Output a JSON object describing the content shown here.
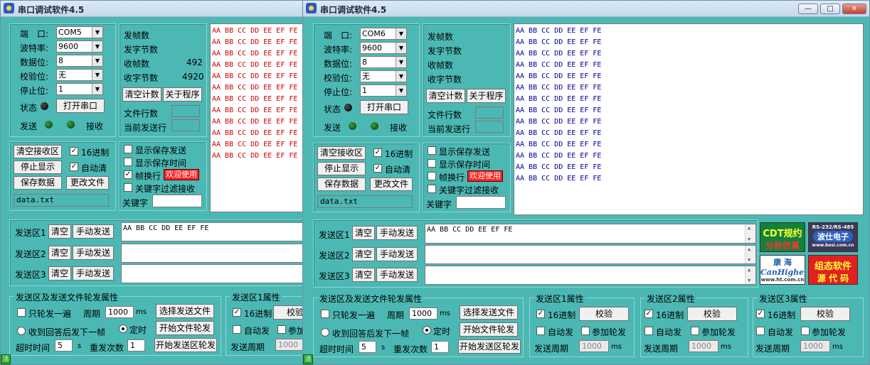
{
  "title": "串口调试软件4.5",
  "window_controls": {
    "minimize": "—",
    "maximize": "□",
    "close": "✕"
  },
  "labels": {
    "port": "端　口:",
    "baud": "波特率:",
    "databits": "数据位:",
    "parity": "校验位:",
    "stopbits": "停止位:",
    "state": "状态",
    "open_port": "打开串口",
    "send": "发送",
    "recv": "接收",
    "tx_frames": "发帧数",
    "tx_bytes": "发字节数",
    "rx_frames": "收帧数",
    "rx_bytes": "收字节数",
    "clear_count": "清空计数",
    "about": "关于程序",
    "file_lines": "文件行数",
    "current_line": "当前发送行",
    "clear_recv": "清空接收区",
    "hex16": "16进制",
    "stop_display": "停止显示",
    "auto_clear": "自动清",
    "save_data": "保存数据",
    "change_file": "更改文件",
    "show_save_send": "显示保存发送",
    "show_save_time": "显示保存时间",
    "frame_newline": "帧换行",
    "welcome": "欢迎使用",
    "keyword_filter": "关键字过滤接收",
    "keyword": "关键字",
    "send_area_1": "发送区1",
    "send_area_2": "发送区2",
    "send_area_3": "发送区3",
    "clear": "清空",
    "manual_send": "手动发送",
    "polling_props": "发送区及发送文件轮发属性",
    "only_once": "只轮发一遍",
    "period": "周期",
    "ms": "ms",
    "select_file": "选择发送文件",
    "wait_reply": "收到回答后发下一帧",
    "timed": "定时",
    "start_file_poll": "开始文件轮发",
    "timeout": "超时时间",
    "s": "s",
    "retry": "重发次数",
    "start_area_poll": "开始发送区轮发",
    "area1_props": "发送区1属性",
    "area2_props": "发送区2属性",
    "area3_props": "发送区3属性",
    "check": "校验",
    "auto_send": "自动发",
    "join_poll": "参加轮发",
    "send_period": "发送周期",
    "status_char": "活"
  },
  "left_window": {
    "port": "COM5",
    "baud": "9600",
    "databits": "8",
    "parity": "无",
    "stopbits": "1",
    "rx_frames_value": "492",
    "rx_bytes_value": "4920",
    "file_name": "data.txt",
    "keyword_value": "",
    "send1_text": "AA BB CC DD EE EF FE",
    "period_value": "1000",
    "timeout_value": "5",
    "retry_value": "1",
    "area1_period": "1000",
    "recv_lines": [
      "AA BB CC DD EE EF FE",
      "AA BB CC DD EE EF FE",
      "AA BB CC DD EE EF FE",
      "AA BB CC DD EE EF FE",
      "AA BB CC DD EE EF FE",
      "AA BB CC DD EE EF FE",
      "AA BB CC DD EE EF FE",
      "AA BB CC DD EE EF FE",
      "AA BB CC DD EE EF FE",
      "AA BB CC DD EE EF FE",
      "AA BB CC DD EE EF FE",
      "AA BB CC DD EE EF FE"
    ]
  },
  "right_window": {
    "port": "COM6",
    "baud": "9600",
    "databits": "8",
    "parity": "无",
    "stopbits": "1",
    "file_name": "data.txt",
    "keyword_value": "",
    "send1_text": "AA BB CC DD EE EF FE",
    "period_value": "1000",
    "timeout_value": "5",
    "retry_value": "1",
    "area_period": "1000",
    "recv_lines": [
      "AA BB CC DD EE EF FE",
      "AA BB CC DD EE EF FE",
      "AA BB CC DD EE EF FE",
      "AA BB CC DD EE EF FE",
      "AA BB CC DD EE EF FE",
      "AA BB CC DD EE EF FE",
      "AA BB CC DD EE EF FE",
      "AA BB CC DD EE EF FE",
      "AA BB CC DD EE EF FE",
      "AA BB CC DD EE EF FE",
      "AA BB CC DD EE EF FE",
      "AA BB CC DD EE EF FE",
      "AA BB CC DD EE EF FE",
      "AA BB CC DD EE EF FE"
    ]
  },
  "ads": {
    "cdt_line1": "CDT规约",
    "cdt_line2": "分析仿真",
    "rs_top": "RS-232/RS-485",
    "rs_mid": "波仕电子",
    "rs_url": "www.bosi.com.cn",
    "kh_line1": "康 海",
    "kh_line2": "CanHigher",
    "kh_url": "www.ht.com.cn",
    "zt_line1": "组态软件",
    "zt_line2": "源 代 码"
  },
  "colors": {
    "window_bg": "#4cb8b4",
    "left_recv_text": "#cc0000",
    "right_recv_text": "#000099"
  }
}
